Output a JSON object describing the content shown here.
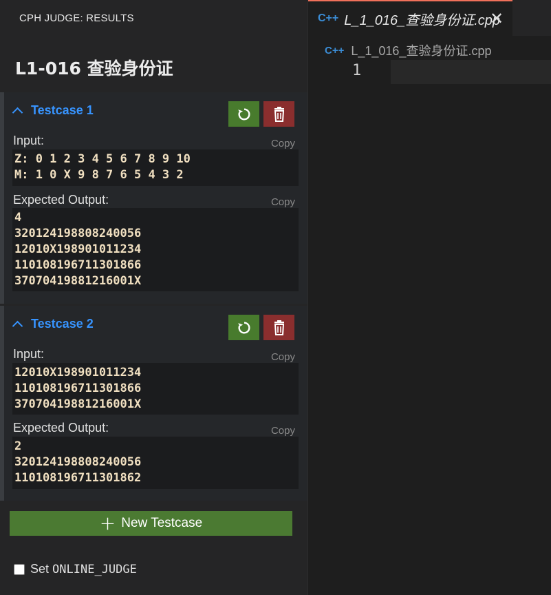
{
  "panel": {
    "title": "CPH JUDGE: RESULTS",
    "problem": "L1-016 查验身份证"
  },
  "testcases": [
    {
      "name": "Testcase 1",
      "input_label": "Input:",
      "input": "Z: 0 1 2 3 4 5 6 7 8 9 10\nM: 1 0 X 9 8 7 6 5 4 3 2",
      "output_label": "Expected Output:",
      "output": "4\n320124198808240056\n12010X198901011234\n110108196711301866\n37070419881216001X",
      "copy": "Copy"
    },
    {
      "name": "Testcase 2",
      "input_label": "Input:",
      "input": "12010X198901011234\n110108196711301866\n37070419881216001X",
      "output_label": "Expected Output:",
      "output": "2\n320124198808240056\n110108196711301862",
      "copy": "Copy"
    }
  ],
  "new_testcase": {
    "label": "New Testcase"
  },
  "online_judge": {
    "prefix": "Set",
    "code": "ONLINE_JUDGE"
  },
  "editor": {
    "icon": "C++",
    "tab_name": "L_1_016_查验身份证.cpp",
    "breadcrumb": "L_1_016_查验身份证.cpp",
    "line_number": "1"
  },
  "colors": {
    "accent_blue": "#3794ff",
    "run_green": "#487b2d",
    "delete_red": "#8a2e2e",
    "tab_border": "#f0705a"
  }
}
